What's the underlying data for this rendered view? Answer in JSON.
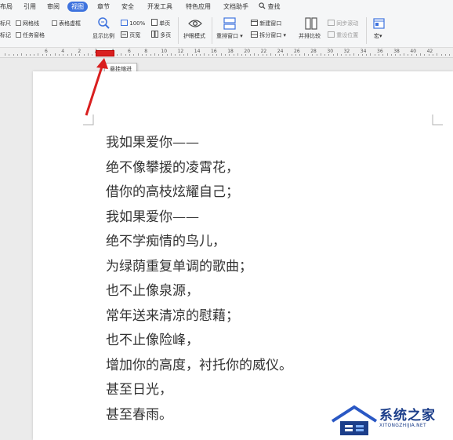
{
  "menu": {
    "tabs": [
      "布局",
      "引用",
      "审阅",
      "视图",
      "章节",
      "安全",
      "开发工具",
      "特色应用",
      "文档助手"
    ],
    "active_tab": "视图",
    "search_label": "查找"
  },
  "ribbon": {
    "show_ruler": "标尺",
    "gridlines": "网格线",
    "table_gridlines": "表格虚框",
    "markup": "标记",
    "task_pane": "任务窗格",
    "zoom_label": "显示比例",
    "hundred_percent": "100%",
    "page_width": "页宽",
    "one_page": "单页",
    "multi_page": "多页",
    "eye_mode": "护眼模式",
    "rearrange_windows": "重排窗口",
    "new_window": "新建窗口",
    "split_window": "拆分窗口",
    "side_by_side": "并排比较",
    "sync_scroll": "同步滚动",
    "reset_position": "重设位置",
    "macro": "宏"
  },
  "ruler": {
    "numbers": [
      "6",
      "4",
      "2",
      "2",
      "4",
      "6",
      "8",
      "10",
      "12",
      "14",
      "16",
      "18",
      "20",
      "22",
      "24",
      "26",
      "28",
      "30",
      "32",
      "34",
      "36",
      "38",
      "40",
      "42"
    ]
  },
  "tooltip": {
    "text": "悬挂缩进"
  },
  "document": {
    "lines": [
      "我如果爱你——",
      "绝不像攀援的凌霄花，",
      "借你的高枝炫耀自己；",
      "我如果爱你——",
      "绝不学痴情的鸟儿，",
      "为绿荫重复单调的歌曲；",
      "也不止像泉源，",
      "常年送来清凉的慰藉；",
      "也不止像险峰，",
      "增加你的高度，衬托你的威仪。",
      "甚至日光，",
      "甚至春雨。"
    ]
  },
  "watermark": {
    "title": "系统之家",
    "subtitle": "XITONGZHIJIA.NET"
  },
  "colors": {
    "accent": "#3e73de",
    "annotation_red": "#d91f1f",
    "watermark_blue": "#1c3e8a"
  }
}
